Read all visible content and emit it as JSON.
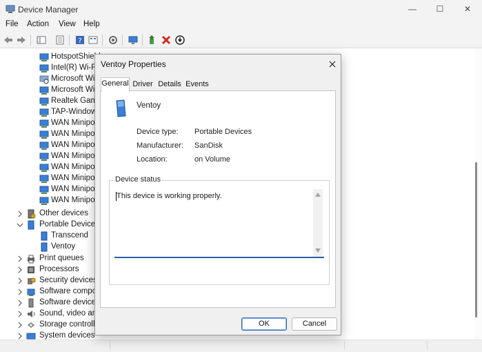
{
  "window": {
    "title": "Device Manager",
    "minimize_glyph": "—",
    "maximize_glyph": "☐",
    "close_glyph": "✕"
  },
  "menu": [
    "File",
    "Action",
    "View",
    "Help"
  ],
  "toolbar_icons": [
    "back-arrow-icon",
    "forward-arrow-icon",
    "console-tree-icon",
    "properties-icon",
    "help-icon",
    "view-icon",
    "scan-hardware-icon",
    "monitor-icon",
    "update-driver-icon",
    "uninstall-icon",
    "disable-device-icon"
  ],
  "tree": {
    "network_adapters": [
      "HotspotShield",
      "Intel(R) Wi-Fi",
      "Microsoft Wi",
      "Microsoft Wi",
      "Realtek Gami",
      "TAP-Window",
      "WAN Minipo",
      "WAN Minipo",
      "WAN Minipo",
      "WAN Minipo",
      "WAN Minipo",
      "WAN Minipo",
      "WAN Minipo",
      "WAN Minipo"
    ],
    "other_devices": "Other devices",
    "portable_devices": {
      "label": "Portable Devices",
      "children": [
        "Transcend",
        "Ventoy"
      ]
    },
    "categories_after": [
      "Print queues",
      "Processors",
      "Security devices",
      "Software compo",
      "Software devices",
      "Sound, video and",
      "Storage controlle",
      "System devices"
    ]
  },
  "dialog": {
    "title": "Ventoy Properties",
    "tabs": [
      "General",
      "Driver",
      "Details",
      "Events"
    ],
    "active_tab": "General",
    "device_name": "Ventoy",
    "properties": [
      {
        "label": "Device type:",
        "value": "Portable Devices"
      },
      {
        "label": "Manufacturer:",
        "value": "SanDisk"
      },
      {
        "label": "Location:",
        "value": "on Volume"
      }
    ],
    "status_group_label": "Device status",
    "status_text": "This device is working properly.",
    "ok_label": "OK",
    "cancel_label": "Cancel"
  },
  "colors": {
    "accent": "#2b67c4",
    "error_red": "#d9261c",
    "network_blue": "#3a7fd5"
  }
}
